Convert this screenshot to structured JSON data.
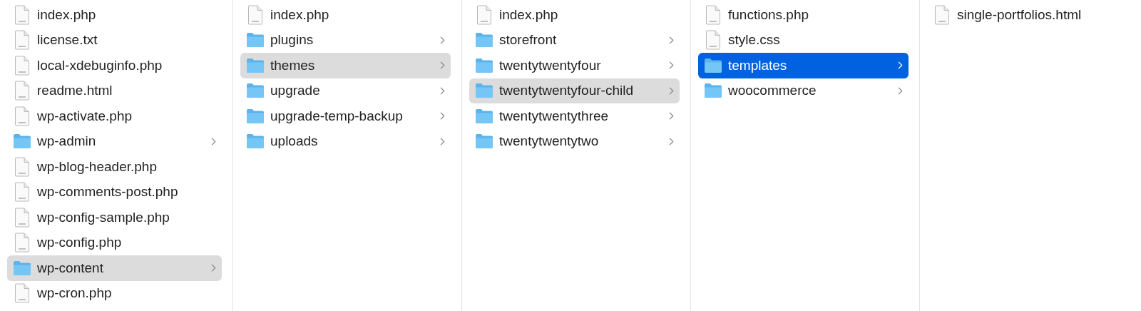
{
  "columns": [
    {
      "items": [
        {
          "name": "index.php",
          "kind": "file",
          "selected": false,
          "focused": false
        },
        {
          "name": "license.txt",
          "kind": "file",
          "selected": false,
          "focused": false
        },
        {
          "name": "local-xdebuginfo.php",
          "kind": "file",
          "selected": false,
          "focused": false
        },
        {
          "name": "readme.html",
          "kind": "file",
          "selected": false,
          "focused": false
        },
        {
          "name": "wp-activate.php",
          "kind": "file",
          "selected": false,
          "focused": false
        },
        {
          "name": "wp-admin",
          "kind": "folder",
          "selected": false,
          "focused": false
        },
        {
          "name": "wp-blog-header.php",
          "kind": "file",
          "selected": false,
          "focused": false
        },
        {
          "name": "wp-comments-post.php",
          "kind": "file",
          "selected": false,
          "focused": false
        },
        {
          "name": "wp-config-sample.php",
          "kind": "file",
          "selected": false,
          "focused": false
        },
        {
          "name": "wp-config.php",
          "kind": "file",
          "selected": false,
          "focused": false
        },
        {
          "name": "wp-content",
          "kind": "folder",
          "selected": true,
          "focused": false
        },
        {
          "name": "wp-cron.php",
          "kind": "file",
          "selected": false,
          "focused": false
        }
      ]
    },
    {
      "items": [
        {
          "name": "index.php",
          "kind": "file",
          "selected": false,
          "focused": false
        },
        {
          "name": "plugins",
          "kind": "folder",
          "selected": false,
          "focused": false
        },
        {
          "name": "themes",
          "kind": "folder",
          "selected": true,
          "focused": false
        },
        {
          "name": "upgrade",
          "kind": "folder",
          "selected": false,
          "focused": false
        },
        {
          "name": "upgrade-temp-backup",
          "kind": "folder",
          "selected": false,
          "focused": false
        },
        {
          "name": "uploads",
          "kind": "folder",
          "selected": false,
          "focused": false
        }
      ]
    },
    {
      "items": [
        {
          "name": "index.php",
          "kind": "file",
          "selected": false,
          "focused": false
        },
        {
          "name": "storefront",
          "kind": "folder",
          "selected": false,
          "focused": false
        },
        {
          "name": "twentytwentyfour",
          "kind": "folder",
          "selected": false,
          "focused": false
        },
        {
          "name": "twentytwentyfour-child",
          "kind": "folder",
          "selected": true,
          "focused": false
        },
        {
          "name": "twentytwentythree",
          "kind": "folder",
          "selected": false,
          "focused": false
        },
        {
          "name": "twentytwentytwo",
          "kind": "folder",
          "selected": false,
          "focused": false
        }
      ]
    },
    {
      "items": [
        {
          "name": "functions.php",
          "kind": "file",
          "selected": false,
          "focused": false
        },
        {
          "name": "style.css",
          "kind": "file",
          "selected": false,
          "focused": false
        },
        {
          "name": "templates",
          "kind": "folder",
          "selected": true,
          "focused": true
        },
        {
          "name": "woocommerce",
          "kind": "folder",
          "selected": false,
          "focused": false
        }
      ]
    },
    {
      "items": [
        {
          "name": "single-portfolios.html",
          "kind": "file",
          "selected": false,
          "focused": false
        }
      ]
    }
  ]
}
